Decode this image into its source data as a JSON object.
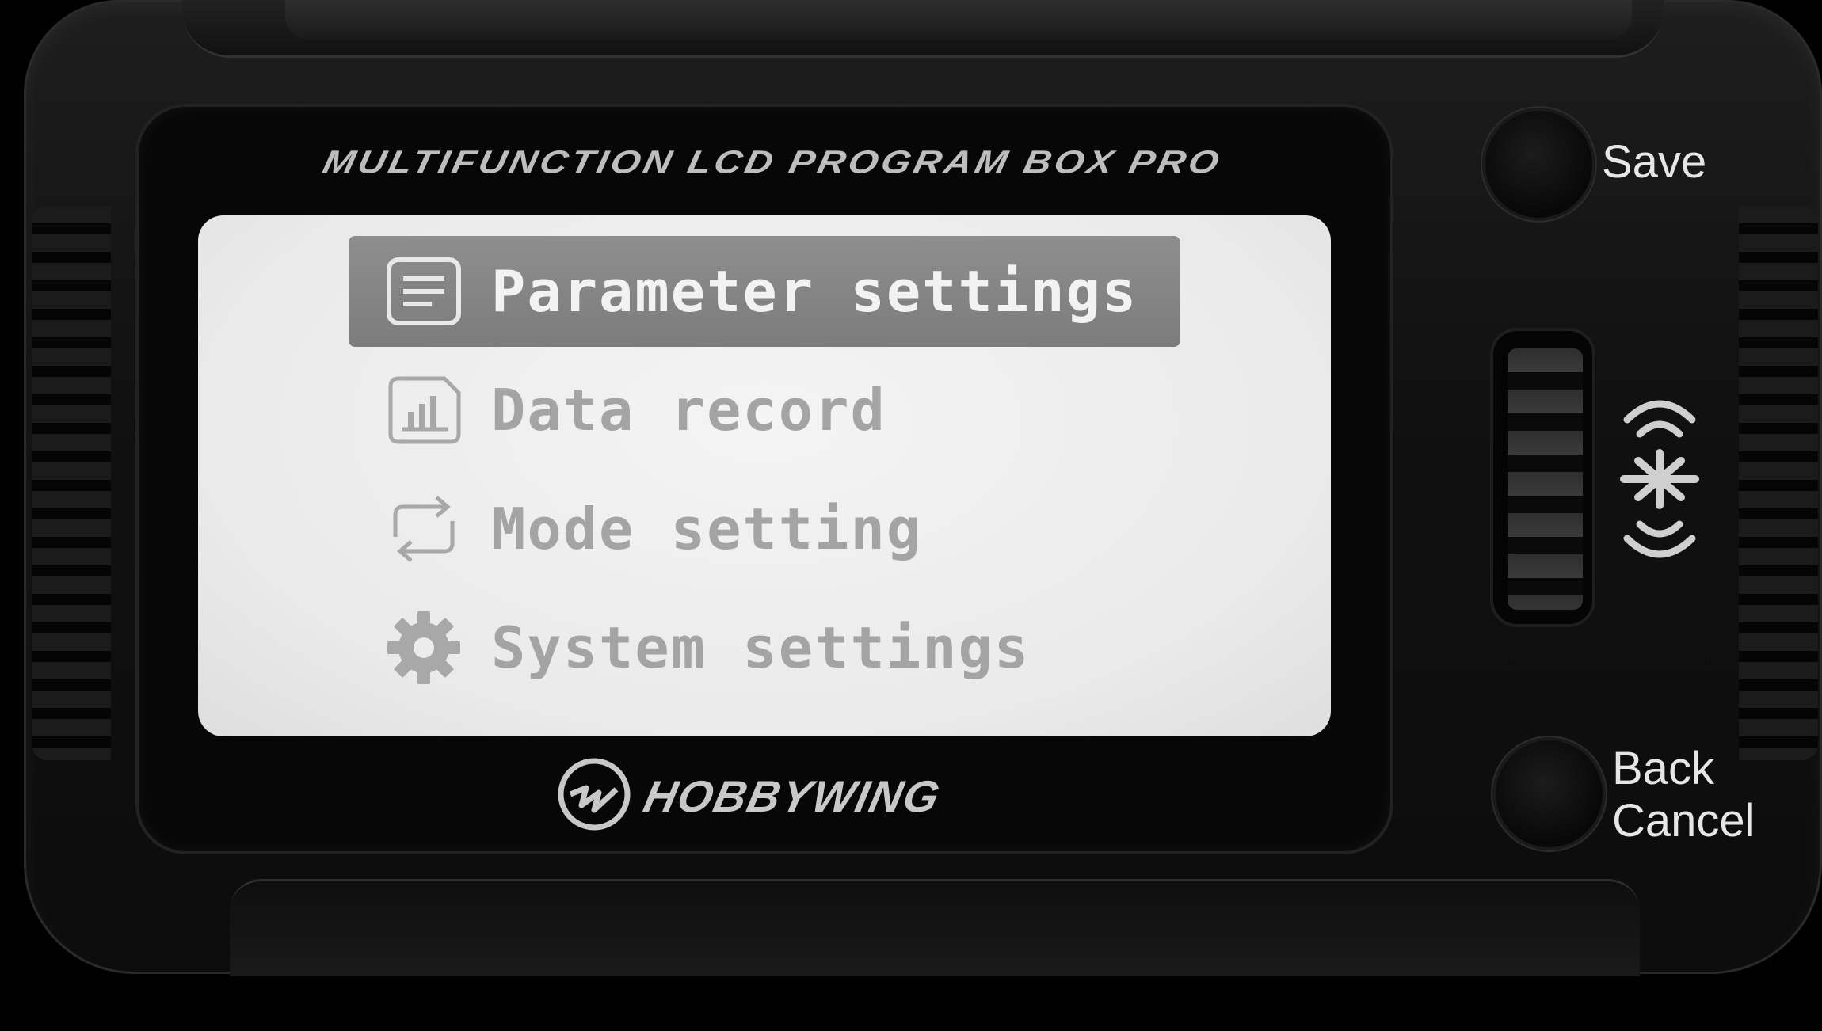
{
  "device": {
    "title": "MULTIFUNCTION LCD PROGRAM BOX PRO",
    "brand": "HOBBYWING"
  },
  "menu": {
    "items": [
      {
        "label": "Parameter settings",
        "icon": "list-icon",
        "selected": true
      },
      {
        "label": "Data record",
        "icon": "bar-chart-icon",
        "selected": false
      },
      {
        "label": "Mode setting",
        "icon": "cycle-arrows-icon",
        "selected": false
      },
      {
        "label": "System settings",
        "icon": "gear-icon",
        "selected": false
      }
    ]
  },
  "buttons": {
    "save_label": "Save",
    "back_label": "Back",
    "cancel_label": "Cancel"
  },
  "colors": {
    "lcd_background": "#ececec",
    "selected_bar": "#858585",
    "menu_text": "#a4a4a4",
    "device_body": "#111111"
  }
}
